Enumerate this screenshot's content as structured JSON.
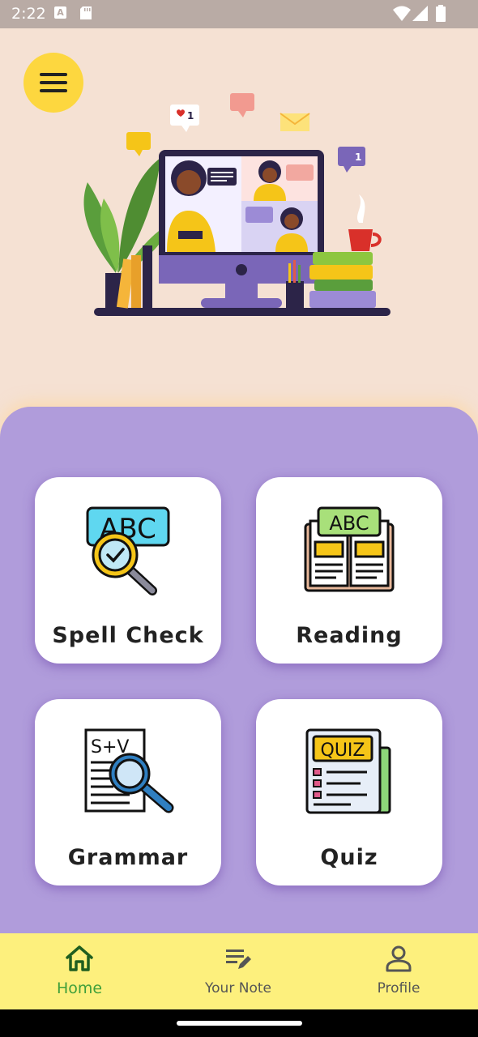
{
  "status_bar": {
    "time": "2:22",
    "icons": [
      "a-notification-icon",
      "sd-card-icon",
      "wifi-icon",
      "cell-signal-icon",
      "battery-icon"
    ]
  },
  "header": {
    "menu_icon": "hamburger-menu-icon",
    "illustration": "online-class-illustration",
    "badge_count_1": "1",
    "badge_count_2": "1"
  },
  "cards": [
    {
      "label": "Spell Check",
      "icon": "spell-check-icon",
      "icon_text": "ABC"
    },
    {
      "label": "Reading",
      "icon": "reading-book-icon",
      "icon_text": "ABC"
    },
    {
      "label": "Grammar",
      "icon": "grammar-icon",
      "icon_text": "S+V"
    },
    {
      "label": "Quiz",
      "icon": "quiz-icon",
      "icon_text": "QUIZ"
    }
  ],
  "bottom_nav": {
    "items": [
      {
        "label": "Home",
        "icon": "home-icon",
        "active": true
      },
      {
        "label": "Your Note",
        "icon": "edit-note-icon",
        "active": false
      },
      {
        "label": "Profile",
        "icon": "profile-icon",
        "active": false
      }
    ]
  },
  "colors": {
    "background": "#f5e1d3",
    "panel": "#b09cdb",
    "menu_button": "#fdd73f",
    "bottom_nav": "#fdf07d",
    "active_nav": "#3f9f3a"
  }
}
